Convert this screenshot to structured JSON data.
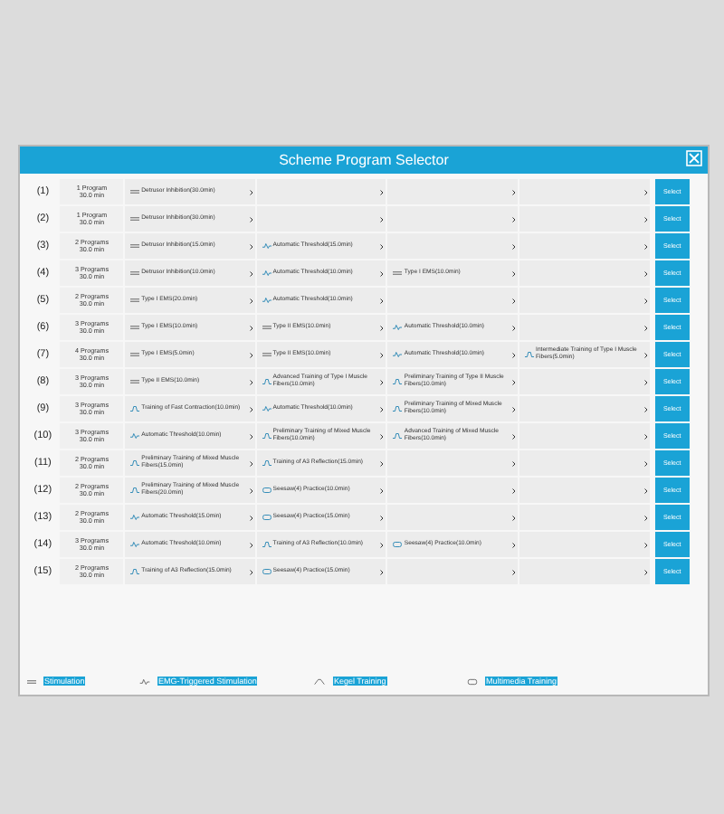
{
  "dialog": {
    "title": "Scheme Program Selector"
  },
  "rows": [
    {
      "number": "(1)",
      "count": "1 Program",
      "duration": "30.0 min",
      "programs": [
        {
          "kind": "stimulation",
          "name": "Detrusor Inhibition(30.0min)"
        }
      ],
      "button": "Select"
    },
    {
      "number": "(2)",
      "count": "1 Program",
      "duration": "30.0 min",
      "programs": [
        {
          "kind": "stimulation",
          "name": "Detrusor Inhibition(30.0min)"
        }
      ],
      "button": "Select"
    },
    {
      "number": "(3)",
      "count": "2 Programs",
      "duration": "30.0 min",
      "programs": [
        {
          "kind": "stimulation",
          "name": "Detrusor Inhibition(15.0min)"
        },
        {
          "kind": "emg",
          "name": "Automatic Threshold(15.0min)"
        }
      ],
      "button": "Select"
    },
    {
      "number": "(4)",
      "count": "3 Programs",
      "duration": "30.0 min",
      "programs": [
        {
          "kind": "stimulation",
          "name": "Detrusor Inhibition(10.0min)"
        },
        {
          "kind": "emg",
          "name": "Automatic Threshold(10.0min)"
        },
        {
          "kind": "stimulation",
          "name": "Type I EMS(10.0min)"
        }
      ],
      "button": "Select"
    },
    {
      "number": "(5)",
      "count": "2 Programs",
      "duration": "30.0 min",
      "programs": [
        {
          "kind": "stimulation",
          "name": "Type I EMS(20.0min)"
        },
        {
          "kind": "emg",
          "name": "Automatic Threshold(10.0min)"
        }
      ],
      "button": "Select"
    },
    {
      "number": "(6)",
      "count": "3 Programs",
      "duration": "30.0 min",
      "programs": [
        {
          "kind": "stimulation",
          "name": "Type I EMS(10.0min)"
        },
        {
          "kind": "stimulation",
          "name": "Type II EMS(10.0min)"
        },
        {
          "kind": "emg",
          "name": "Automatic Threshold(10.0min)"
        }
      ],
      "button": "Select"
    },
    {
      "number": "(7)",
      "count": "4 Programs",
      "duration": "30.0 min",
      "programs": [
        {
          "kind": "stimulation",
          "name": "Type I EMS(5.0min)"
        },
        {
          "kind": "stimulation",
          "name": "Type II EMS(10.0min)"
        },
        {
          "kind": "emg",
          "name": "Automatic Threshold(10.0min)"
        },
        {
          "kind": "kegel",
          "name": "Intermediate Training of Type I Muscle Fibers(5.0min)"
        }
      ],
      "button": "Select"
    },
    {
      "number": "(8)",
      "count": "3 Programs",
      "duration": "30.0 min",
      "programs": [
        {
          "kind": "stimulation",
          "name": "Type II EMS(10.0min)"
        },
        {
          "kind": "kegel",
          "name": "Advanced Training of Type I Muscle Fibers(10.0min)"
        },
        {
          "kind": "kegel",
          "name": "Preliminary Training of Type II Muscle Fibers(10.0min)"
        }
      ],
      "button": "Select"
    },
    {
      "number": "(9)",
      "count": "3 Programs",
      "duration": "30.0 min",
      "programs": [
        {
          "kind": "kegel",
          "name": "Training of Fast Contraction(10.0min)"
        },
        {
          "kind": "emg",
          "name": "Automatic Threshold(10.0min)"
        },
        {
          "kind": "kegel",
          "name": "Preliminary Training of Mixed Muscle Fibers(10.0min)"
        }
      ],
      "button": "Select"
    },
    {
      "number": "(10)",
      "count": "3 Programs",
      "duration": "30.0 min",
      "programs": [
        {
          "kind": "emg",
          "name": "Automatic Threshold(10.0min)"
        },
        {
          "kind": "kegel",
          "name": "Preliminary Training of Mixed Muscle Fibers(10.0min)"
        },
        {
          "kind": "kegel",
          "name": "Advanced Training of Mixed Muscle Fibers(10.0min)"
        }
      ],
      "button": "Select"
    },
    {
      "number": "(11)",
      "count": "2 Programs",
      "duration": "30.0 min",
      "programs": [
        {
          "kind": "kegel",
          "name": "Preliminary Training of Mixed Muscle Fibers(15.0min)"
        },
        {
          "kind": "kegel",
          "name": "Training of A3 Reflection(15.0min)"
        }
      ],
      "button": "Select"
    },
    {
      "number": "(12)",
      "count": "2 Programs",
      "duration": "30.0 min",
      "programs": [
        {
          "kind": "kegel",
          "name": "Preliminary Training of Mixed Muscle Fibers(20.0min)"
        },
        {
          "kind": "multimedia",
          "name": "Seesaw(4) Practice(10.0min)"
        }
      ],
      "button": "Select"
    },
    {
      "number": "(13)",
      "count": "2 Programs",
      "duration": "30.0 min",
      "programs": [
        {
          "kind": "emg",
          "name": "Automatic Threshold(15.0min)"
        },
        {
          "kind": "multimedia",
          "name": "Seesaw(4) Practice(15.0min)"
        }
      ],
      "button": "Select"
    },
    {
      "number": "(14)",
      "count": "3 Programs",
      "duration": "30.0 min",
      "programs": [
        {
          "kind": "emg",
          "name": "Automatic Threshold(10.0min)"
        },
        {
          "kind": "kegel",
          "name": "Training of A3 Reflection(10.0min)"
        },
        {
          "kind": "multimedia",
          "name": "Seesaw(4) Practice(10.0min)"
        }
      ],
      "button": "Select"
    },
    {
      "number": "(15)",
      "count": "2 Programs",
      "duration": "30.0 min",
      "programs": [
        {
          "kind": "kegel",
          "name": "Training of A3 Reflection(15.0min)"
        },
        {
          "kind": "multimedia",
          "name": "Seesaw(4) Practice(15.0min)"
        }
      ],
      "button": "Select"
    }
  ],
  "legend": [
    {
      "kind": "stimulation",
      "label": "Stimulation"
    },
    {
      "kind": "emg",
      "label": "EMG-Triggered Stimulation"
    },
    {
      "kind": "kegel",
      "label": "Kegel Training"
    },
    {
      "kind": "multimedia",
      "label": "Multimedia Training"
    }
  ]
}
